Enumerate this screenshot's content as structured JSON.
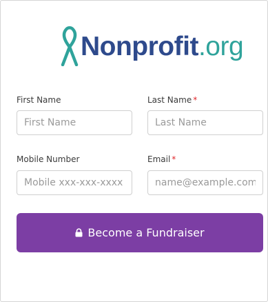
{
  "brand": {
    "name_bold": "Nonprofit",
    "name_light": ".org",
    "ribbon_icon": "awareness-ribbon-icon",
    "color_dark": "#2e4a8c",
    "color_teal": "#2fa39b"
  },
  "form": {
    "first_name": {
      "label": "First Name",
      "placeholder": "First Name",
      "required": false
    },
    "last_name": {
      "label": "Last Name",
      "required_mark": "*",
      "placeholder": "Last Name",
      "required": true
    },
    "mobile": {
      "label": "Mobile Number",
      "placeholder": "Mobile xxx-xxx-xxxx",
      "required": false
    },
    "email": {
      "label": "Email",
      "required_mark": "*",
      "placeholder": "name@example.com",
      "required": true
    }
  },
  "submit": {
    "label": "Become a Fundraiser",
    "icon": "lock-icon",
    "color": "#7c3ea4"
  }
}
